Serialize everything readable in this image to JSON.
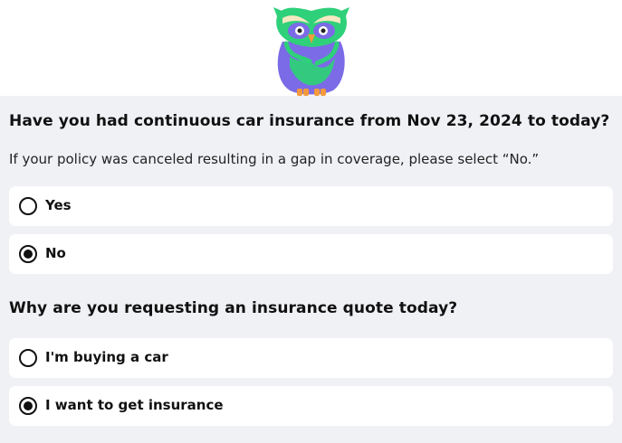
{
  "questions": {
    "continuous_insurance": {
      "title": "Have you had continuous car insurance from Nov 23, 2024 to today?",
      "hint": "If your policy was canceled resulting in a gap in coverage, please select “No.”",
      "options": [
        {
          "label": "Yes",
          "selected": false
        },
        {
          "label": "No",
          "selected": true
        }
      ]
    },
    "quote_reason": {
      "title": "Why are you requesting an insurance quote today?",
      "options": [
        {
          "label": "I'm buying a car",
          "selected": false
        },
        {
          "label": "I want to get insurance",
          "selected": true
        }
      ]
    }
  },
  "mascot": {
    "icon": "owl-mascot-icon",
    "colors": {
      "body": "#7b6be6",
      "feathers": "#2fd07a",
      "feet": "#f39a3c",
      "beak": "#f39a3c",
      "brow": "#f5e9c2"
    }
  }
}
